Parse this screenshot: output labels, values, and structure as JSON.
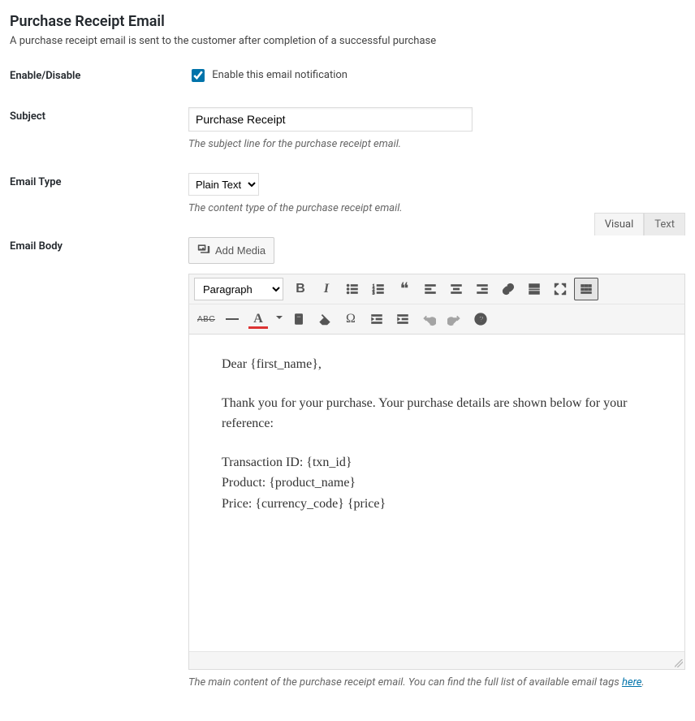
{
  "header": {
    "title": "Purchase Receipt Email",
    "description": "A purchase receipt email is sent to the customer after completion of a successful purchase"
  },
  "enable": {
    "label": "Enable/Disable",
    "checkbox_label": "Enable this email notification",
    "checked": true
  },
  "subject": {
    "label": "Subject",
    "value": "Purchase Receipt",
    "help": "The subject line for the purchase receipt email."
  },
  "email_type": {
    "label": "Email Type",
    "selected": "Plain Text",
    "help": "The content type of the purchase receipt email."
  },
  "body": {
    "label": "Email Body",
    "add_media": "Add Media",
    "tab_visual": "Visual",
    "tab_text": "Text",
    "format_selected": "Paragraph",
    "content_p1": "Dear {first_name},",
    "content_p2": "Thank you for your purchase. Your purchase details are shown below for your reference:",
    "content_l1": "Transaction ID: {txn_id}",
    "content_l2": "Product: {product_name}",
    "content_l3": "Price: {currency_code} {price}",
    "help_pre": "The main content of the purchase receipt email. You can find the full list of available email tags ",
    "help_link": "here",
    "help_post": "."
  }
}
